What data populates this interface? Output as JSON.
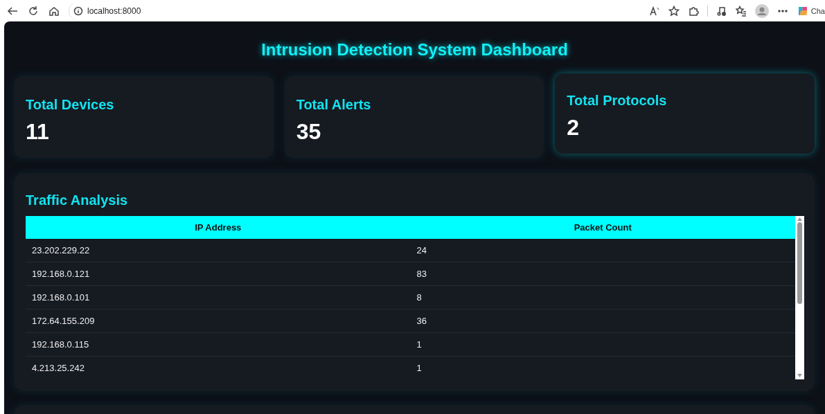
{
  "browser": {
    "address": "localhost:8000",
    "sidebar_label": "Cha"
  },
  "dashboard": {
    "title": "Intrusion Detection System Dashboard",
    "stats": [
      {
        "label": "Total Devices",
        "value": "11",
        "highlighted": false
      },
      {
        "label": "Total Alerts",
        "value": "35",
        "highlighted": false
      },
      {
        "label": "Total Protocols",
        "value": "2",
        "highlighted": true
      }
    ],
    "traffic": {
      "title": "Traffic Analysis",
      "columns": [
        "IP Address",
        "Packet Count"
      ],
      "rows": [
        [
          "23.202.229.22",
          "24"
        ],
        [
          "192.168.0.121",
          "83"
        ],
        [
          "192.168.0.101",
          "8"
        ],
        [
          "172.64.155.209",
          "36"
        ],
        [
          "192.168.0.115",
          "1"
        ],
        [
          "4.213.25.242",
          "1"
        ]
      ]
    }
  }
}
